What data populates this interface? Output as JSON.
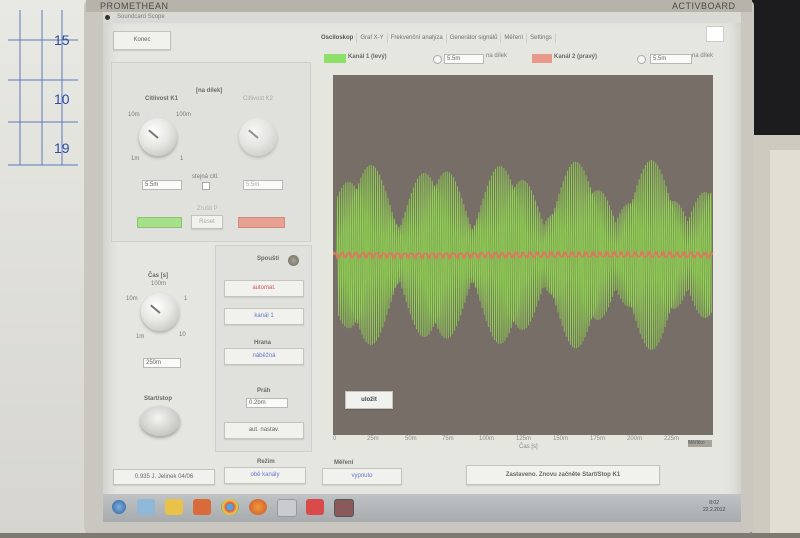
{
  "brand": {
    "left": "PROMETHEAN",
    "right": "ACTIVBOARD"
  },
  "board_marks": [
    "15",
    "10",
    "19"
  ],
  "window": {
    "title": "Soundcard Scope"
  },
  "menu_button": "Konec",
  "tabs": [
    "Osciloskop",
    "Graf X-Y",
    "Frekvenční analýza",
    "Generátor signálů",
    "Měření",
    "Settings"
  ],
  "channel1": {
    "label": "Kanál 1 (levý)",
    "value": "5.5m",
    "unit": "na dílek",
    "color": "#7fd35f"
  },
  "channel2": {
    "label": "Kanál 2 (pravý)",
    "value": "5.5m",
    "unit": "na dílek",
    "color": "#d98a7c"
  },
  "sensitivity": {
    "heading": "[na dílek]",
    "knob1": {
      "label": "Citlivost K1",
      "ticks": [
        "10m",
        "100m",
        "1m",
        "1"
      ],
      "value": "5.5m"
    },
    "knob2": {
      "label": "Citlivost K2",
      "value": "5.5m"
    },
    "same_label": "stejná citl.",
    "link_label": "Zrušit P",
    "link_button": "Reset"
  },
  "time": {
    "label": "Čas [s]",
    "ticks": [
      "100m",
      "10m",
      "1",
      "1m",
      "10"
    ],
    "value": "250m",
    "start_stop": "Start/stop"
  },
  "trigger": {
    "heading": "Spouští",
    "mode": "automat.",
    "source": "kanál 1",
    "edge_label": "Hrana",
    "edge": "náběžná",
    "threshold_label": "Práh",
    "threshold": "0.2bm",
    "auto_button": "aut. nastav."
  },
  "plot": {
    "save_button": "uložit",
    "xticks": [
      "0",
      "25m",
      "50m",
      "75m",
      "100m",
      "125m",
      "150m",
      "175m",
      "200m",
      "225m"
    ],
    "xunit": "Čas [s]",
    "corner": "Měřítko"
  },
  "bottom": {
    "version": "0.935  J. Jelinek 04/06",
    "display_label": "Režim",
    "display_value": "obě kanály",
    "measure_label": "Měření",
    "measure_value": "vypnuto",
    "status": "Zastaveno. Znovu začněte Start/Stop    K1"
  },
  "taskbar": {
    "time": "8:02",
    "date": "22.2.2012"
  },
  "chart_data": {
    "type": "line",
    "series": [
      {
        "name": "Kanál 1 (levý)",
        "color": "#8fd44f"
      },
      {
        "name": "Kanál 2 (pravý)",
        "color": "#d97a5e"
      }
    ],
    "xlim": [
      0,
      250
    ],
    "xunit": "ms"
  }
}
